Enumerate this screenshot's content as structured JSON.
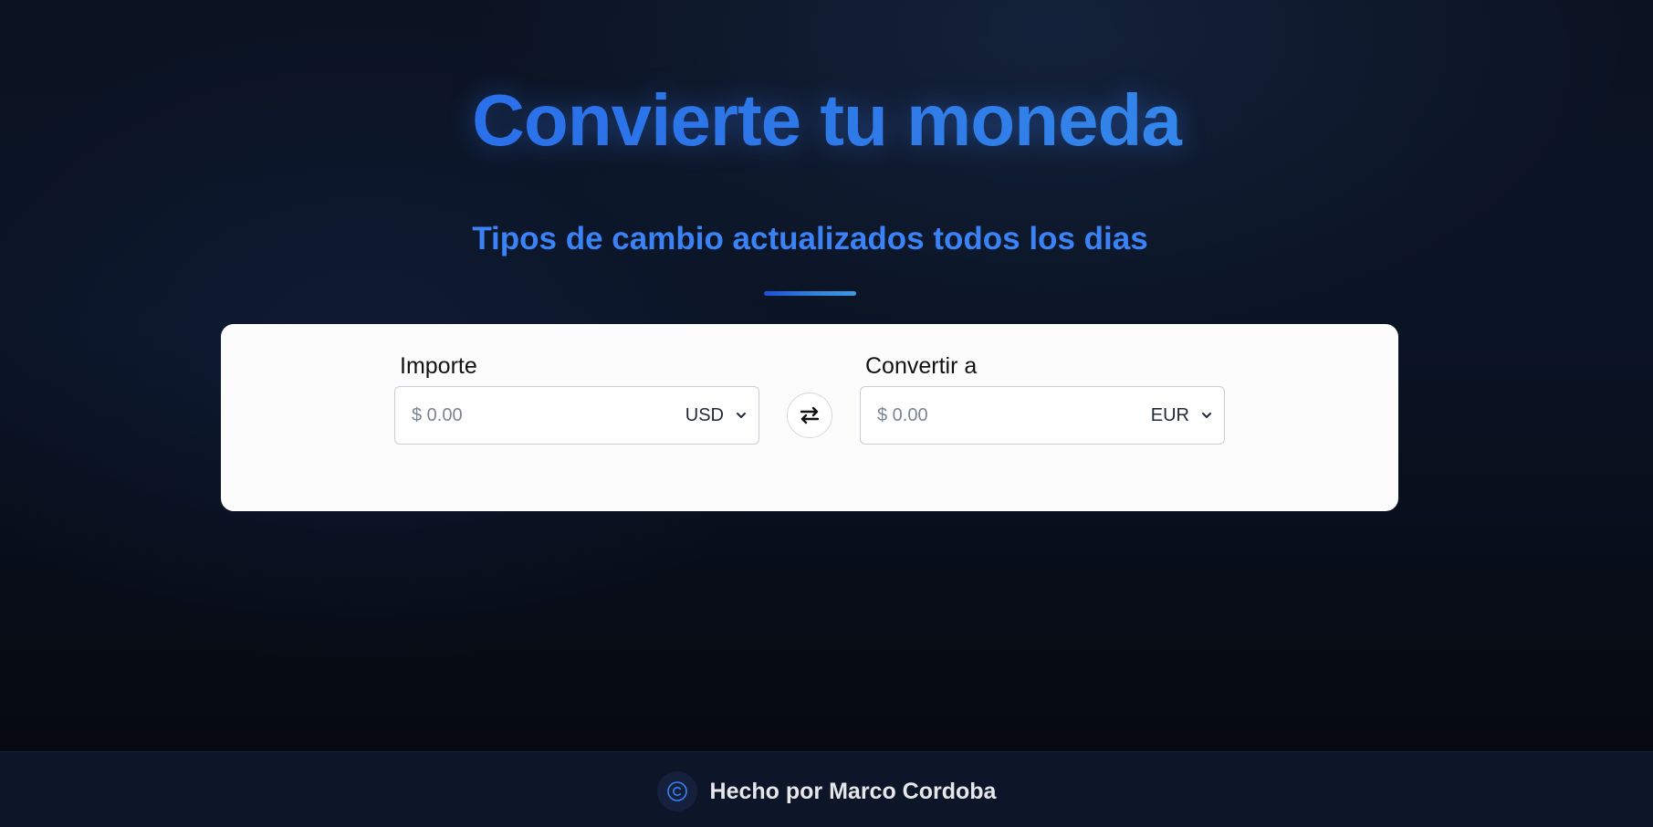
{
  "hero": {
    "title": "Convierte tu moneda",
    "subtitle": "Tipos de cambio actualizados todos los dias"
  },
  "converter": {
    "from": {
      "label": "Importe",
      "placeholder": "$ 0.00",
      "currency": "USD"
    },
    "to": {
      "label": "Convertir a",
      "placeholder": "$ 0.00",
      "currency": "EUR"
    },
    "swap_icon": "swap-arrows-icon"
  },
  "footer": {
    "icon": "copyright-icon",
    "text": "Hecho por Marco Cordoba"
  },
  "colors": {
    "accent": "#3b82f6",
    "title_gradient_start": "#2563eb",
    "title_gradient_end": "#3b9af0",
    "background": "#0b1322",
    "card": "#fcfcfc"
  }
}
